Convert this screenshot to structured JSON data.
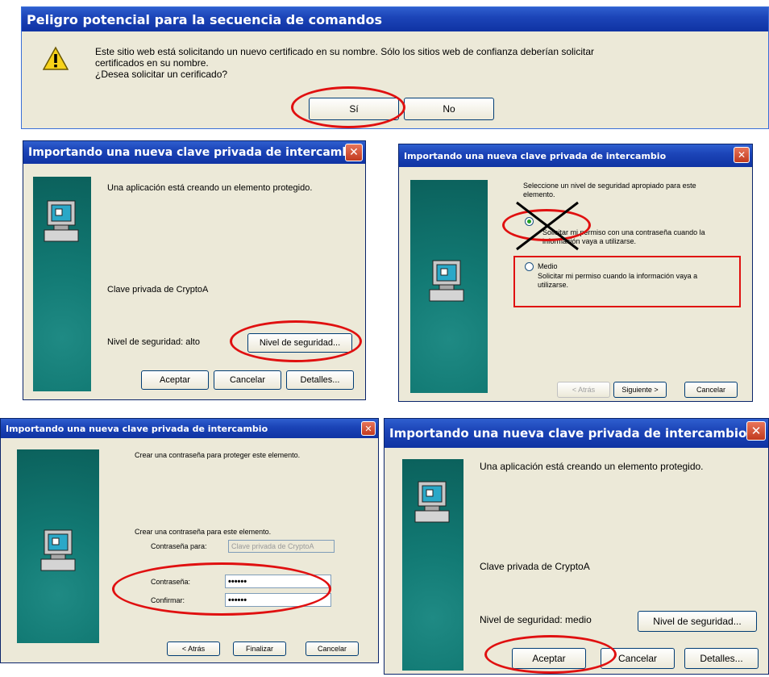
{
  "colors": {
    "titlebar": "#1c45b8",
    "dialog_bg": "#ece9d8",
    "panel_teal": "#127a74",
    "annotation_red": "#e01010"
  },
  "warning": {
    "title": "Peligro potencial para la secuencia de comandos",
    "line1": "Este sitio web está solicitando un nuevo certificado en su nombre. Sólo los sitios web de confianza deberían solicitar",
    "line2": "certificados en su nombre.",
    "line3": "¿Desea solicitar un cerificado?",
    "yes": "Sí",
    "no": "No",
    "icon": "warning-icon"
  },
  "dialog_a": {
    "title": "Importando una nueva clave privada de intercambio",
    "message": "Una aplicación está creando un elemento protegido.",
    "key_name": "Clave privada de CryptoA",
    "security_level": "Nivel de seguridad: alto",
    "security_button": "Nivel de seguridad...",
    "ok": "Aceptar",
    "cancel": "Cancelar",
    "details": "Detalles..."
  },
  "dialog_b": {
    "title": "Importando una nueva clave privada de intercambio",
    "instruction_1": "Seleccione un nivel de seguridad apropiado para este",
    "instruction_2": "elemento.",
    "high_desc_1": "Solicitar mi permiso con una contraseña cuando la",
    "high_desc_2": "información vaya a utilizarse.",
    "medium_label": "Medio",
    "medium_desc_1": "Solicitar mi permiso cuando la información vaya a",
    "medium_desc_2": "utilizarse.",
    "back": "< Atrás",
    "next": "Siguiente >",
    "cancel": "Cancelar"
  },
  "dialog_c": {
    "title": "Importando una nueva clave privada de intercambio",
    "instruction": "Crear una contraseña para proteger este elemento.",
    "password_heading": "Crear una contraseña para este elemento.",
    "for_label": "Contraseña para:",
    "for_value": "Clave privada de CryptoA",
    "password_label": "Contraseña:",
    "password_value": "••••••",
    "confirm_label": "Confirmar:",
    "confirm_value": "••••••",
    "back": "< Atrás",
    "finish": "Finalizar",
    "cancel": "Cancelar"
  },
  "dialog_d": {
    "title": "Importando una nueva clave privada de intercambio",
    "message": "Una aplicación está creando un elemento protegido.",
    "key_name": "Clave privada de CryptoA",
    "security_level": "Nivel de seguridad: medio",
    "security_button": "Nivel de seguridad...",
    "ok": "Aceptar",
    "cancel": "Cancelar",
    "details": "Detalles..."
  }
}
